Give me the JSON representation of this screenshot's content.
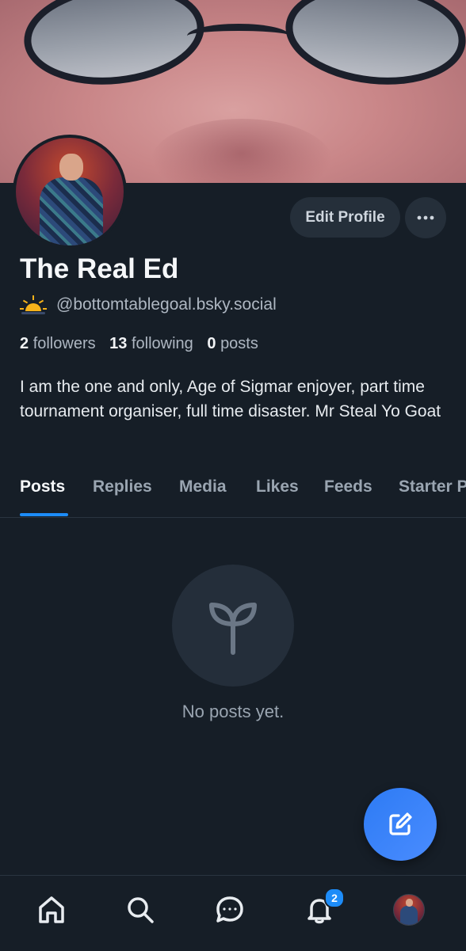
{
  "profile": {
    "display_name": "The Real Ed",
    "handle": "@bottomtablegoal.bsky.social",
    "stats": {
      "followers_count": "2",
      "followers_label": "followers",
      "following_count": "13",
      "following_label": "following",
      "posts_count": "0",
      "posts_label": "posts"
    },
    "bio": "I am the one and only, Age of Sigmar enjoyer, part time tournament organiser, full time disaster. Mr Steal Yo Goat"
  },
  "actions": {
    "edit_profile_label": "Edit Profile",
    "more_icon": "more-horizontal-icon"
  },
  "tabs": [
    {
      "label": "Posts",
      "active": true
    },
    {
      "label": "Replies",
      "active": false
    },
    {
      "label": "Media",
      "active": false
    },
    {
      "label": "Likes",
      "active": false
    },
    {
      "label": "Feeds",
      "active": false
    },
    {
      "label": "Starter Packs",
      "active": false
    }
  ],
  "empty_state": {
    "icon": "seedling-icon",
    "text": "No posts yet."
  },
  "fab": {
    "icon": "compose-icon"
  },
  "bottom_nav": {
    "items": [
      "home-icon",
      "search-icon",
      "chat-icon",
      "bell-icon",
      "avatar"
    ],
    "notifications_badge": "2"
  },
  "colors": {
    "background": "#161e27",
    "accent": "#1d8cf8",
    "button_bg": "#252f3a",
    "muted_text": "#aeb7c2"
  }
}
